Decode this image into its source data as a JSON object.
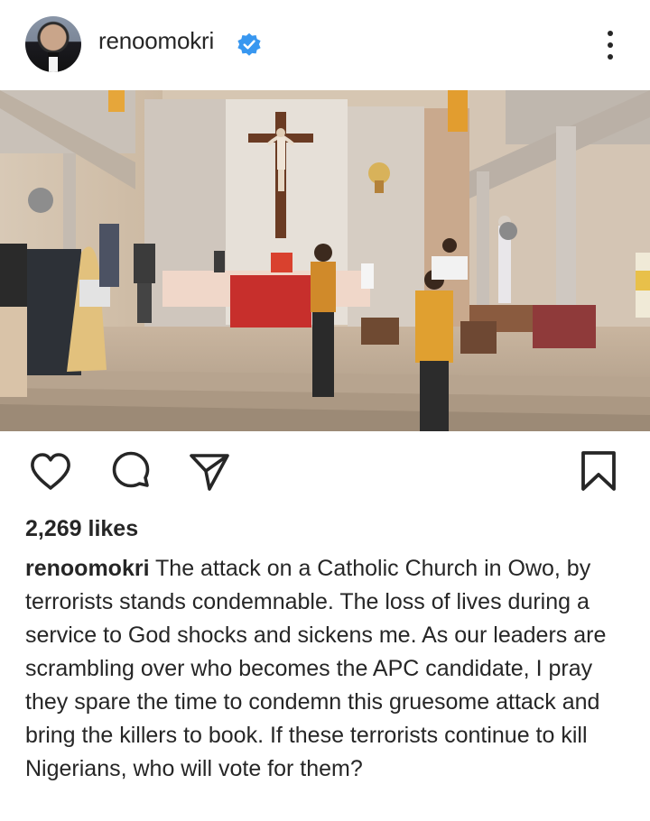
{
  "post": {
    "username": "renoomokri",
    "verified": true,
    "likes": "2,269 likes",
    "caption_user": "renoomokri",
    "caption_text": "The attack on a Catholic Church in Owo, by terrorists stands condemnable. The loss of lives during a service to God shocks and sickens me. As our leaders are scrambling over who becomes the APC candidate, I pray they spare the time to condemn this gruesome attack and bring the killers to book. If these terrorists continue to kill Nigerians, who will vote for them?"
  },
  "icons": {
    "verified": "verified-badge-icon",
    "more": "more-options-icon",
    "like": "heart-icon",
    "comment": "comment-icon",
    "share": "send-icon",
    "save": "bookmark-icon"
  },
  "colors": {
    "text": "#262626",
    "verified": "#3897f0",
    "background": "#ffffff"
  }
}
